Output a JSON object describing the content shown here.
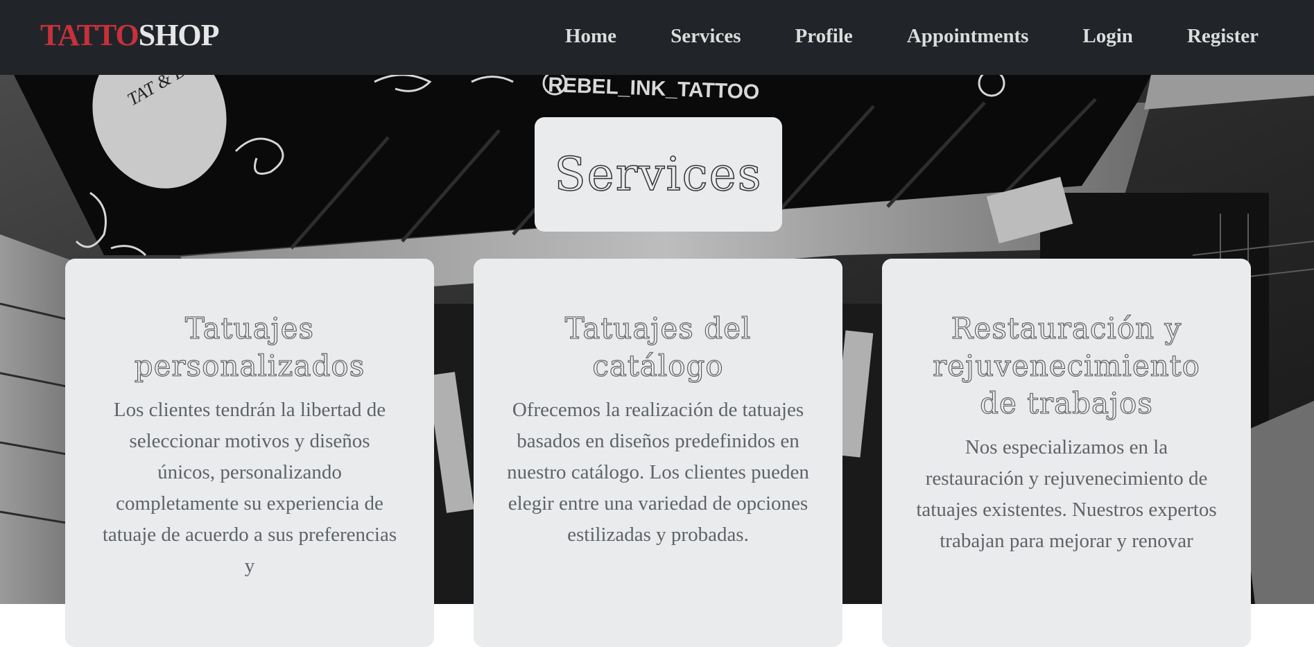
{
  "navbar": {
    "brand_part1": "TATTO",
    "brand_part2": "SHOP",
    "links": [
      "Home",
      "Services",
      "Profile",
      "Appointments",
      "Login",
      "Register"
    ]
  },
  "hero": {
    "sign_text": "REBEL_INK_TATTOO",
    "sign_badge": "TAT & BODY PIERCING"
  },
  "page_title": "Services",
  "cards": [
    {
      "title": "Tatuajes personalizados",
      "description": "Los clientes tendrán la libertad de seleccionar motivos y diseños únicos, personalizando completamente su experiencia de tatuaje de acuerdo a sus preferencias y"
    },
    {
      "title": "Tatuajes del catálogo",
      "description": "Ofrecemos la realización de tatuajes basados en diseños predefinidos en nuestro catálogo. Los clientes pueden elegir entre una variedad de opciones estilizadas y probadas."
    },
    {
      "title": "Restauración y rejuvenecimiento de trabajos",
      "description": "Nos especializamos en la restauración y rejuvenecimiento de tatuajes existentes. Nuestros expertos trabajan para mejorar y renovar"
    }
  ],
  "colors": {
    "navbar_bg": "#212529",
    "brand_red": "#c8303b",
    "card_bg": "#e9ebed",
    "text_gray": "#5f6368"
  }
}
